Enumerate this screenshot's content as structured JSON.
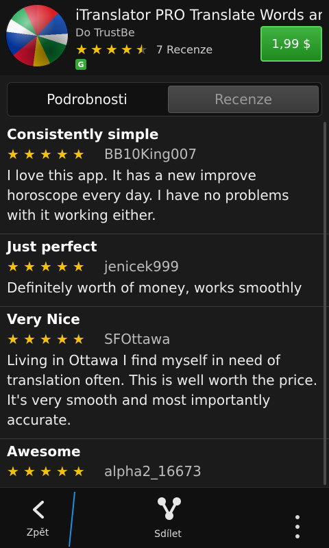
{
  "header": {
    "app_title": "iTranslator PRO Translate Words an",
    "developer": "Do TrustBe",
    "rating_stars": 4.5,
    "review_count": "7 Recenze",
    "badge": "G",
    "price": "1,99 $"
  },
  "tabs": [
    {
      "label": "Podrobnosti"
    },
    {
      "label": "Recenze"
    }
  ],
  "reviews": [
    {
      "title": "Consistently simple",
      "author": "BB10King007",
      "stars": 5,
      "body": "I love this app. It has a new improve horoscope every day. I have no problems with it working either."
    },
    {
      "title": "Just perfect",
      "author": "jenicek999",
      "stars": 5,
      "body": "Definitely worth of money, works smoothly"
    },
    {
      "title": "Very Nice",
      "author": "SFOttawa",
      "stars": 5,
      "body": "Living in Ottawa I find myself in need of translation often. This is well worth the price. It's very smooth and most importantly accurate."
    },
    {
      "title": "Awesome",
      "author": "alpha2_16673",
      "stars": 5,
      "body": ""
    }
  ],
  "actionbar": {
    "back_label": "Zpět",
    "share_label": "Sdílet"
  },
  "colors": {
    "star": "#f4c20d",
    "price_button": "#2e9e2e",
    "accent_line": "#1e8fe0"
  }
}
